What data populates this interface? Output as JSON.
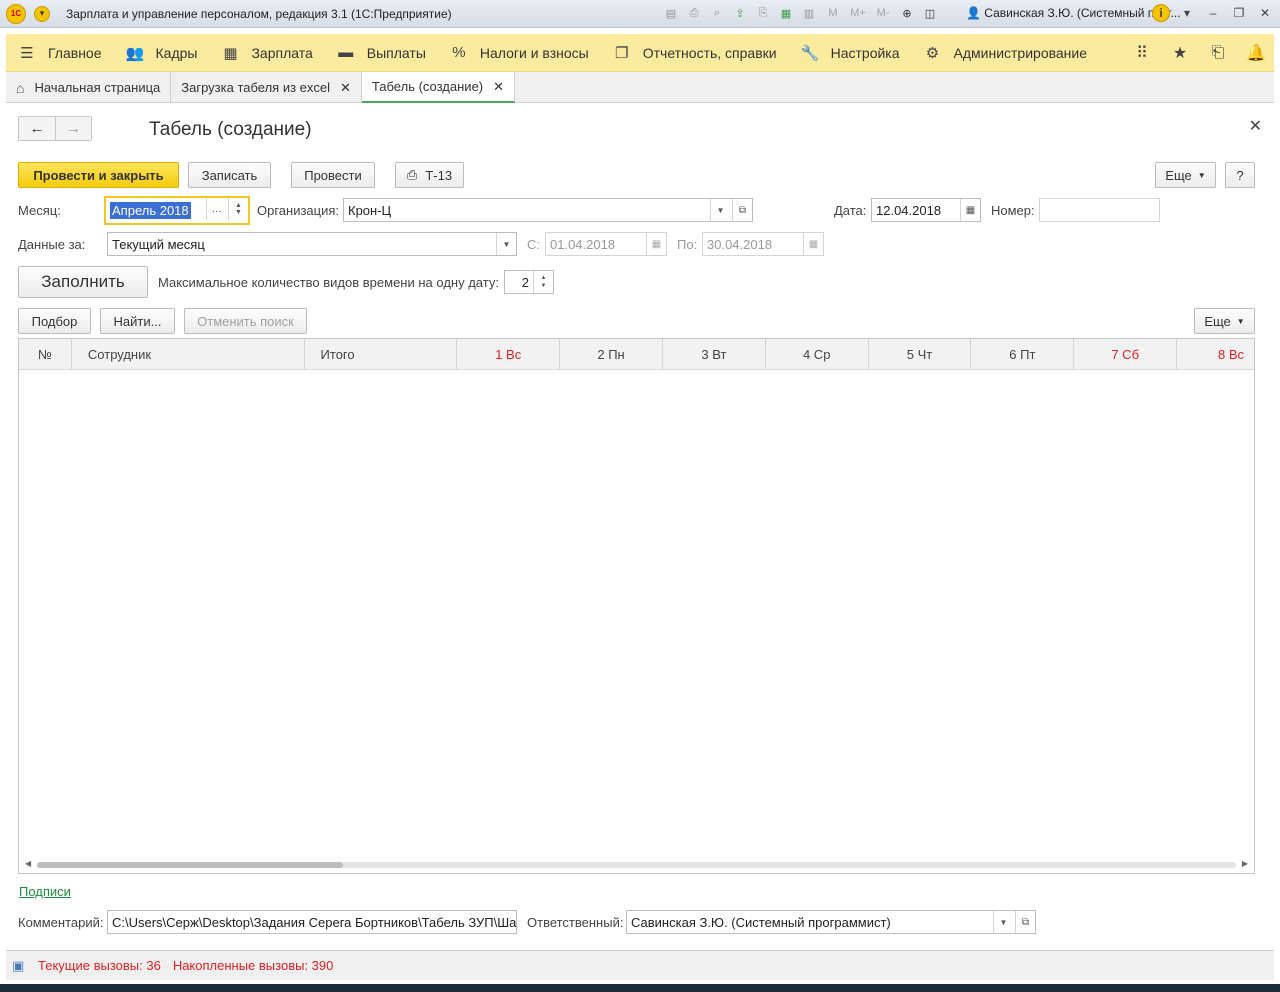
{
  "window": {
    "title": "Зарплата и управление персоналом, редакция 3.1  (1С:Предприятие)",
    "logo": "1С",
    "user": "Савинская З.Ю. (Системный прог...",
    "tools": [
      "save-icon",
      "print-icon",
      "preview-icon",
      "upload-icon",
      "print2-icon",
      "calculator-icon",
      "calendar-icon"
    ],
    "memory_labels": [
      "M",
      "M+",
      "M-"
    ]
  },
  "mainmenu": {
    "items": [
      {
        "label": "Главное",
        "icon": "menu-icon"
      },
      {
        "label": "Кадры",
        "icon": "people-icon"
      },
      {
        "label": "Зарплата",
        "icon": "calculator-icon"
      },
      {
        "label": "Выплаты",
        "icon": "wallet-icon"
      },
      {
        "label": "Налоги и взносы",
        "icon": "percent-icon"
      },
      {
        "label": "Отчетность, справки",
        "icon": "reports-icon"
      },
      {
        "label": "Настройка",
        "icon": "wrench-icon"
      },
      {
        "label": "Администрирование",
        "icon": "gear-icon"
      }
    ]
  },
  "tabs": [
    {
      "label": "Начальная страница"
    },
    {
      "label": "Загрузка табеля из excel"
    },
    {
      "label": "Табель (создание)"
    }
  ],
  "form": {
    "title": "Табель (создание)",
    "buttons": {
      "post_close": "Провести и закрыть",
      "save": "Записать",
      "post": "Провести",
      "print": "Т-13",
      "more": "Еще",
      "help": "?",
      "fill": "Заполнить",
      "select": "Подбор",
      "find": "Найти...",
      "cancel_search": "Отменить поиск",
      "more2": "Еще"
    },
    "fields": {
      "month_label": "Месяц:",
      "month_value": "Апрель 2018",
      "org_label": "Организация:",
      "org_value": "Крон-Ц",
      "date_label": "Дата:",
      "date_value": "12.04.2018",
      "number_label": "Номер:",
      "number_value": "",
      "data_label": "Данные за:",
      "data_value": "Текущий месяц",
      "from_label": "С:",
      "from_value": "01.04.2018",
      "to_label": "По:",
      "to_value": "30.04.2018",
      "max_label": "Максимальное количество видов времени на одну дату:",
      "max_value": "2"
    },
    "table": {
      "columns": [
        {
          "label": "№"
        },
        {
          "label": "Сотрудник"
        },
        {
          "label": "Итого"
        },
        {
          "label": "1 Вс",
          "weekend": true
        },
        {
          "label": "2 Пн"
        },
        {
          "label": "3 Вт"
        },
        {
          "label": "4 Ср"
        },
        {
          "label": "5 Чт"
        },
        {
          "label": "6 Пт"
        },
        {
          "label": "7 Сб",
          "weekend": true
        },
        {
          "label": "8 Вс",
          "weekend": true
        }
      ],
      "rows": []
    },
    "signatures_link": "Подписи",
    "comment_label": "Комментарий:",
    "comment_value": "C:\\Users\\Серж\\Desktop\\Задания Серега Бортников\\Табель ЗУП\\Ша",
    "responsible_label": "Ответственный:",
    "responsible_value": "Савинская З.Ю. (Системный программист)"
  },
  "status": {
    "current_calls": "Текущие вызовы: 36",
    "accumulated_calls": "Накопленные вызовы: 390"
  },
  "colors": {
    "accent_yellow": "#f3cc0f",
    "menu_bg": "#fbeb9f",
    "weekend_red": "#d22222",
    "link_green": "#1e8a3e"
  }
}
